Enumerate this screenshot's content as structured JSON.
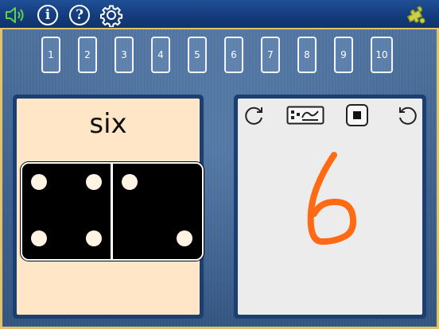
{
  "toolbar": {
    "info_label": "i",
    "help_label": "?"
  },
  "numbers": [
    "1",
    "2",
    "3",
    "4",
    "5",
    "6",
    "7",
    "8",
    "9",
    "10"
  ],
  "card": {
    "word": "six",
    "domino": {
      "left_pips": 4,
      "right_pips": 2
    }
  },
  "drawing": {
    "digit": "6",
    "stroke_color": "#ff6a12"
  },
  "colors": {
    "toolbar_bg": "#143d7d",
    "accent_gold": "#e3c36a",
    "card_bg": "#ffe6c7",
    "canvas_bg": "#ececec"
  },
  "icons": [
    "speaker-icon",
    "info-icon",
    "help-icon",
    "gear-icon",
    "puzzle-icon",
    "undo-icon",
    "draw-mode-icon",
    "stop-icon",
    "redo-icon"
  ]
}
